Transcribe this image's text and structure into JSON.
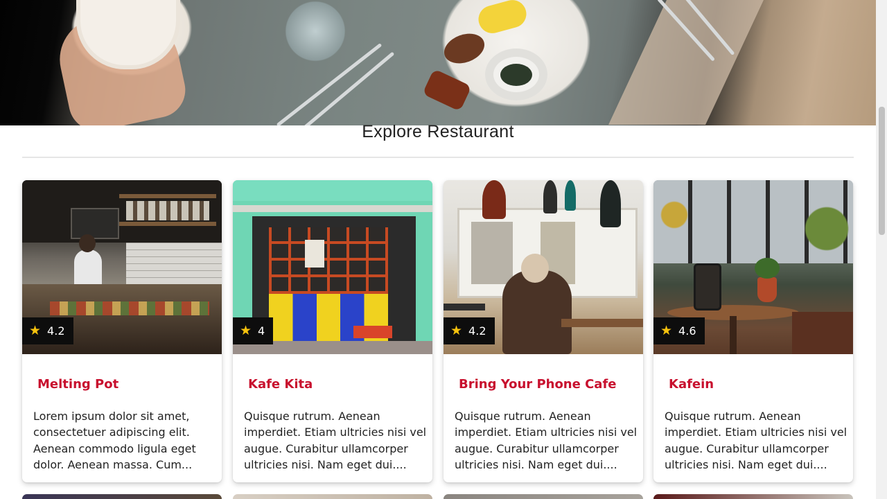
{
  "section": {
    "title": "Explore Restaurant"
  },
  "restaurants": [
    {
      "name": "Melting Pot",
      "rating": "4.2",
      "description": "Lorem ipsum dolor sit amet, consectetuer adipiscing elit. Aenean commodo ligula eget dolor. Aenean massa. Cum..."
    },
    {
      "name": "Kafe Kita",
      "rating": "4",
      "description": "Quisque rutrum. Aenean imperdiet. Etiam ultricies nisi vel augue. Curabitur ullamcorper ultricies nisi. Nam eget dui...."
    },
    {
      "name": "Bring Your Phone Cafe",
      "rating": "4.2",
      "description": "Quisque rutrum. Aenean imperdiet. Etiam ultricies nisi vel augue. Curabitur ullamcorper ultricies nisi. Nam eget dui...."
    },
    {
      "name": "Kafein",
      "rating": "4.6",
      "description": "Quisque rutrum. Aenean imperdiet. Etiam ultricies nisi vel augue. Curabitur ullamcorper ultricies nisi. Nam eget dui...."
    }
  ],
  "colors": {
    "title_accent": "#c8102e",
    "star": "#f6c20d",
    "rating_badge_bg": "#0d0d0d"
  },
  "icons": {
    "rating": "star-icon"
  }
}
